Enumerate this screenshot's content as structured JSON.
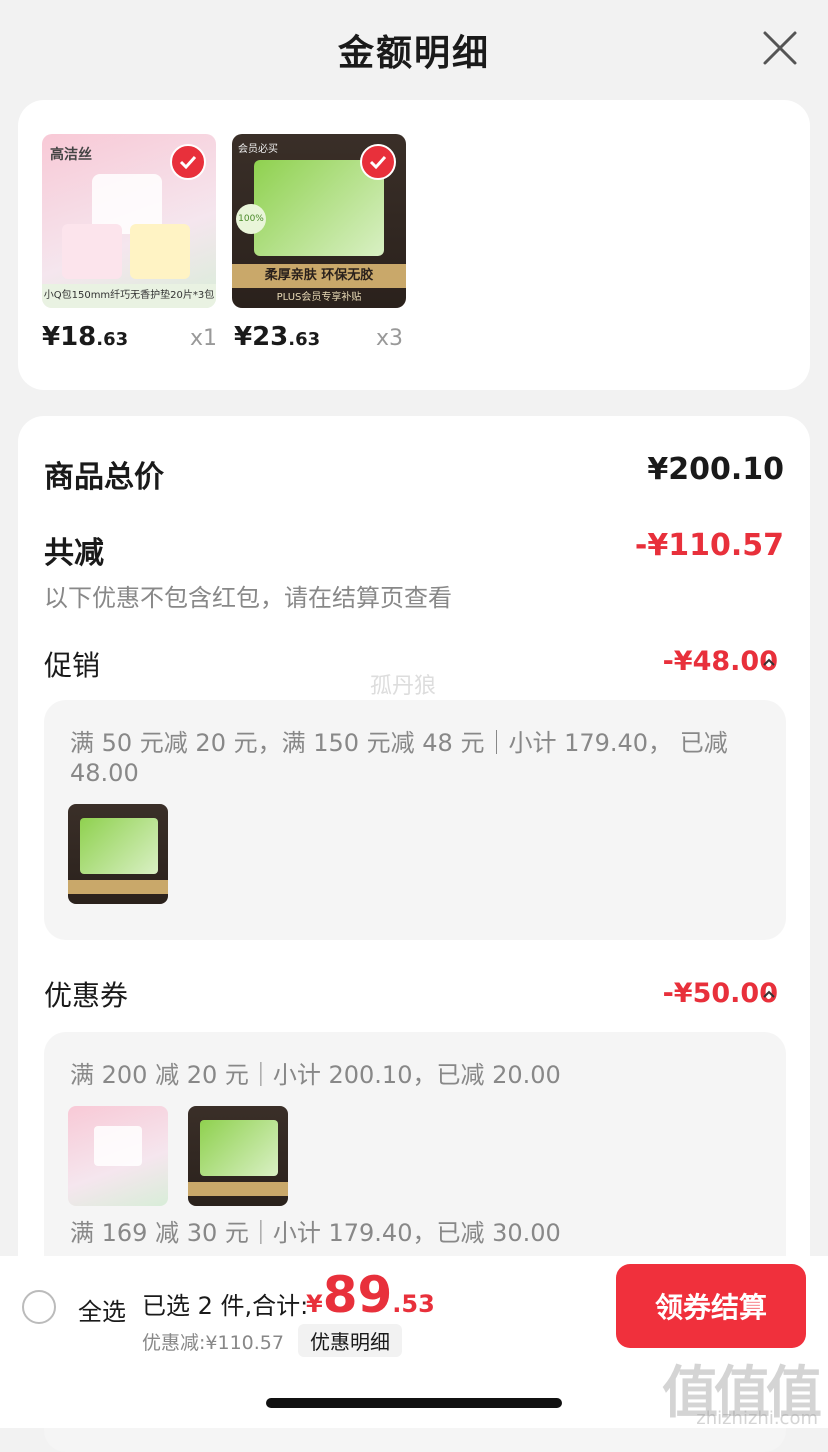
{
  "header": {
    "title": "金额明细"
  },
  "products": [
    {
      "label": "小Q包150mm纤巧无香护垫20片*3包",
      "brand": "高洁丝",
      "price_int": "¥18",
      "price_dec": ".63",
      "qty": "x1",
      "checked": true
    },
    {
      "label": "柔厚亲肤 环保无胶",
      "sub": "PLUS会员专享补贴",
      "badge": "会员必买",
      "price_int": "¥23",
      "price_dec": ".63",
      "qty": "x3",
      "checked": true
    }
  ],
  "summary": {
    "goods_total_label": "商品总价",
    "goods_total_value": "¥200.10",
    "total_reduce_label": "共减",
    "total_reduce_value": "-¥110.57",
    "note": "以下优惠不包含红包，请在结算页查看"
  },
  "promotion": {
    "label": "促销",
    "value": "-¥48.00",
    "detail": "满 50 元减 20 元，满 150 元减 48 元｜小计 179.40， 已减 48.00"
  },
  "watermark": "孤丹狼",
  "coupon": {
    "label": "优惠券",
    "value": "-¥50.00",
    "detail1": "满 200 减 20 元｜小计 200.10，已减 20.00",
    "detail2": "满 169 减 30 元｜小计 179.40，已减 30.00"
  },
  "bottom_bar": {
    "select_all": "全选",
    "selected_info": "已选 2 件,合计:",
    "total_currency": "¥",
    "total_int": "89",
    "total_dec": ".53",
    "discount_text": "优惠减:¥110.57",
    "detail_button": "优惠明细",
    "pay_button": "领券结算"
  },
  "corner_watermark": {
    "main": "值值值",
    "sub": "zhizhizhi.com"
  },
  "colors": {
    "accent": "#e8303b",
    "pay_button": "#f0303c"
  }
}
